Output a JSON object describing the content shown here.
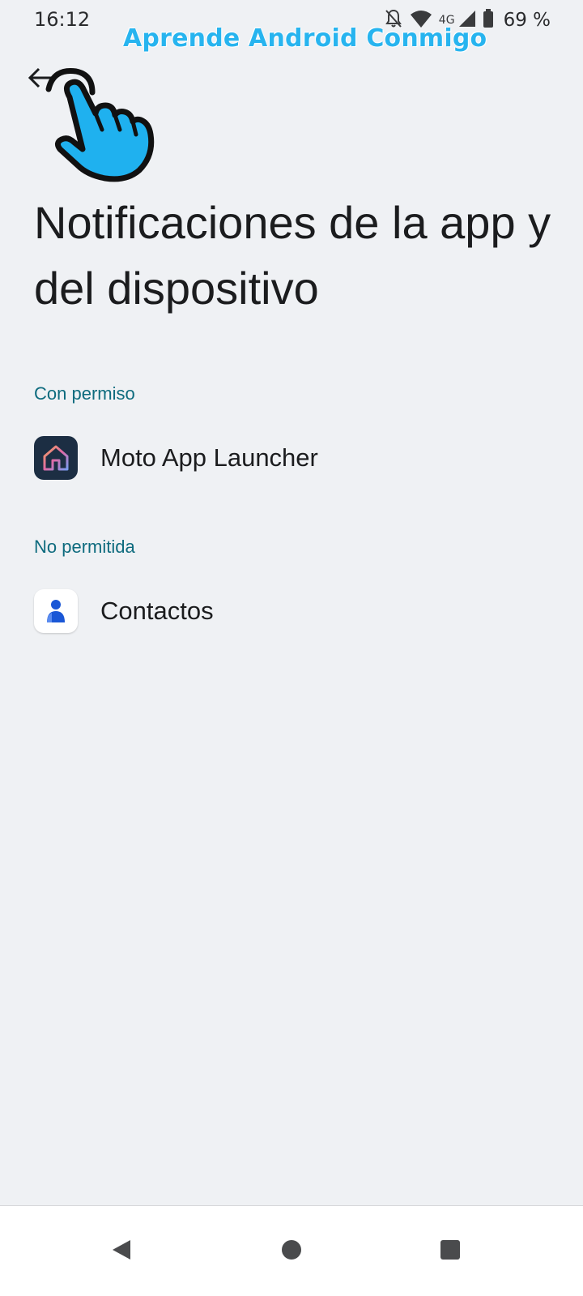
{
  "status_bar": {
    "time": "16:12",
    "network": "4G",
    "battery": "69 %",
    "icons": [
      "notifications-off-icon",
      "wifi-icon",
      "cell-signal-icon",
      "battery-icon"
    ]
  },
  "watermark": "Aprende Android Conmigo",
  "header": {
    "back_icon": "arrow-back-icon",
    "title": "Notificaciones de la app y del dispositivo"
  },
  "sections": [
    {
      "header": "Con permiso",
      "apps": [
        {
          "name": "Moto App Launcher",
          "icon": "moto-launcher-home-icon"
        }
      ]
    },
    {
      "header": "No permitida",
      "apps": [
        {
          "name": "Contactos",
          "icon": "contacts-person-icon"
        }
      ]
    }
  ],
  "nav_bar": {
    "buttons": [
      "nav-back-icon",
      "nav-home-icon",
      "nav-recents-icon"
    ]
  },
  "colors": {
    "background": "#eff1f4",
    "section_header": "#0e6b7e",
    "watermark": "#27b4ef",
    "launcher_bg": "#1c2e43",
    "contacts_blue": "#1a57d6"
  }
}
